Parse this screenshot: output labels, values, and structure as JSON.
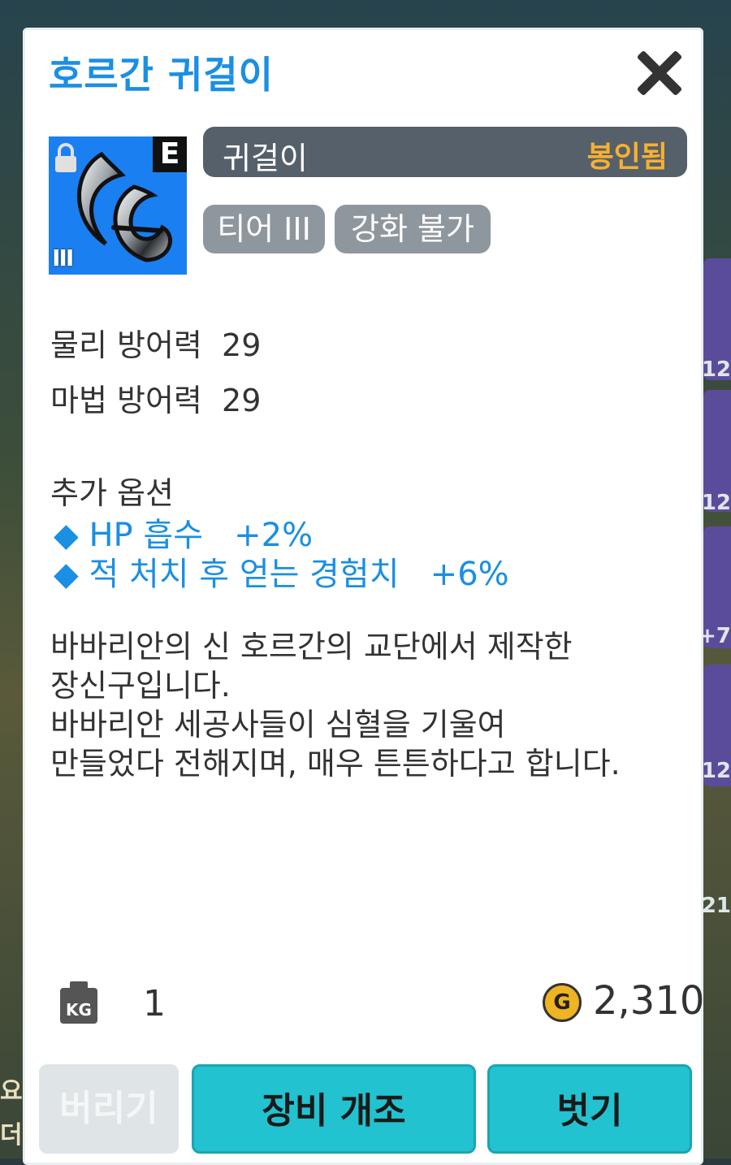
{
  "item": {
    "title": "호르간 귀걸이",
    "grade_letter": "E",
    "tier_roman": "III",
    "type_label": "귀걸이",
    "sealed_label": "봉인됨",
    "tags": [
      "티어 III",
      "강화 불가"
    ]
  },
  "stats": [
    "물리 방어력  29",
    "마법 방어력  29"
  ],
  "extra_options": {
    "title": "추가 옵션",
    "items": [
      "◆ HP 흡수   +2%",
      "◆ 적 처치 후 얻는 경험치   +6%"
    ]
  },
  "description": [
    "바바리안의 신 호르간의 교단에서 제작한",
    "장신구입니다.",
    "바바리안 세공사들이 심혈을 기울여",
    "만들었다 전해지며, 매우 튼튼하다고 합니다."
  ],
  "footer": {
    "weight_icon_text": "KG",
    "weight_value": "1",
    "gold_icon_text": "G",
    "gold_value": "2,310"
  },
  "buttons": {
    "drop": "버리기",
    "modify": "장비 개조",
    "unequip": "벗기"
  },
  "background": {
    "right_numbers": [
      "12",
      "12",
      "+7",
      "12",
      "21"
    ],
    "left_texts": [
      "요!",
      "더"
    ]
  },
  "colors": {
    "title": "#1b8fe3",
    "sealed": "#f5b131",
    "option": "#1b8fe3",
    "button": "#22c2d0"
  },
  "icons": [
    "lock-icon",
    "close-icon",
    "kg-weight-icon",
    "gold-coin-icon",
    "earring-icon"
  ]
}
